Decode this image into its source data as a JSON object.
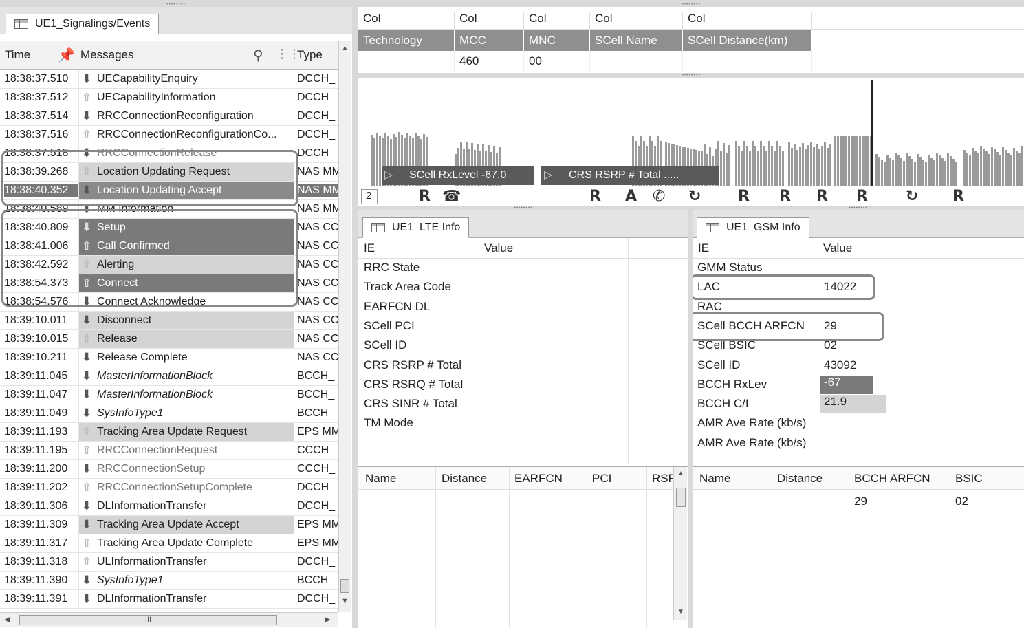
{
  "left_panel": {
    "tab_title": "UE1_Signalings/Events",
    "columns": {
      "time": "Time",
      "messages": "Messages",
      "type": "Type"
    },
    "rows": [
      {
        "time": "18:38:37.510",
        "dir": "down",
        "msg": "UECapabilityEnquiry",
        "type": "DCCH_",
        "style": ""
      },
      {
        "time": "18:38:37.512",
        "dir": "up",
        "msg": "UECapabilityInformation",
        "type": "DCCH_",
        "style": ""
      },
      {
        "time": "18:38:37.514",
        "dir": "down",
        "msg": "RRCConnectionReconfiguration",
        "type": "DCCH_",
        "style": ""
      },
      {
        "time": "18:38:37.516",
        "dir": "up",
        "msg": "RRCConnectionReconfigurationCo...",
        "type": "DCCH_",
        "style": ""
      },
      {
        "time": "18:38:37.518",
        "dir": "down",
        "msg": "RRCConnectionRelease",
        "type": "DCCH_",
        "style": "dim"
      },
      {
        "time": "18:38:39.268",
        "dir": "up",
        "msg": "Location Updating Request",
        "type": "NAS MM",
        "style": "light"
      },
      {
        "time": "18:38:40.352",
        "dir": "down",
        "msg": "Location Updating Accept",
        "type": "NAS MM",
        "style": "sel"
      },
      {
        "time": "18:38:40.589",
        "dir": "down",
        "msg": "MM Information",
        "type": "NAS MM",
        "style": ""
      },
      {
        "time": "18:38:40.809",
        "dir": "down",
        "msg": "Setup",
        "type": "NAS CC",
        "style": "dark"
      },
      {
        "time": "18:38:41.006",
        "dir": "up",
        "msg": "Call Confirmed",
        "type": "NAS CC",
        "style": "dark"
      },
      {
        "time": "18:38:42.592",
        "dir": "up",
        "msg": "Alerting",
        "type": "NAS CC",
        "style": "light"
      },
      {
        "time": "18:38:54.373",
        "dir": "up",
        "msg": "Connect",
        "type": "NAS CC",
        "style": "dark"
      },
      {
        "time": "18:38:54.576",
        "dir": "down",
        "msg": "Connect Acknowledge",
        "type": "NAS CC",
        "style": ""
      },
      {
        "time": "18:39:10.011",
        "dir": "down",
        "msg": "Disconnect",
        "type": "NAS CC",
        "style": "light"
      },
      {
        "time": "18:39:10.015",
        "dir": "up",
        "msg": "Release",
        "type": "NAS CC",
        "style": "light"
      },
      {
        "time": "18:39:10.211",
        "dir": "down",
        "msg": "Release Complete",
        "type": "NAS CC",
        "style": ""
      },
      {
        "time": "18:39:11.045",
        "dir": "down",
        "msg": "MasterInformationBlock",
        "type": "BCCH_",
        "style": "italic"
      },
      {
        "time": "18:39:11.047",
        "dir": "down",
        "msg": "MasterInformationBlock",
        "type": "BCCH_",
        "style": "italic"
      },
      {
        "time": "18:39:11.049",
        "dir": "down",
        "msg": "SysInfoType1",
        "type": "BCCH_",
        "style": "italic"
      },
      {
        "time": "18:39:11.193",
        "dir": "up",
        "msg": "Tracking Area Update Request",
        "type": "EPS MM",
        "style": "light"
      },
      {
        "time": "18:39:11.195",
        "dir": "up",
        "msg": "RRCConnectionRequest",
        "type": "CCCH_",
        "style": "dim"
      },
      {
        "time": "18:39:11.200",
        "dir": "down",
        "msg": "RRCConnectionSetup",
        "type": "CCCH_",
        "style": "dim"
      },
      {
        "time": "18:39:11.202",
        "dir": "up",
        "msg": "RRCConnectionSetupComplete",
        "type": "DCCH_",
        "style": "dim"
      },
      {
        "time": "18:39:11.306",
        "dir": "down",
        "msg": "DLInformationTransfer",
        "type": "DCCH_",
        "style": ""
      },
      {
        "time": "18:39:11.309",
        "dir": "down",
        "msg": "Tracking Area Update Accept",
        "type": "EPS MM",
        "style": "light"
      },
      {
        "time": "18:39:11.317",
        "dir": "up",
        "msg": "Tracking Area Update Complete",
        "type": "EPS MM",
        "style": ""
      },
      {
        "time": "18:39:11.318",
        "dir": "up",
        "msg": "ULInformationTransfer",
        "type": "DCCH_",
        "style": ""
      },
      {
        "time": "18:39:11.390",
        "dir": "down",
        "msg": "SysInfoType1",
        "type": "BCCH_",
        "style": "italic"
      },
      {
        "time": "18:39:11.391",
        "dir": "down",
        "msg": "DLInformationTransfer",
        "type": "DCCH_",
        "style": ""
      }
    ],
    "scroll_thumb_label": "III"
  },
  "top_grid": {
    "col_headers": [
      "Col",
      "Col",
      "Col",
      "Col",
      "Col"
    ],
    "field_headers": [
      "Technology",
      "MCC",
      "MNC",
      "SCell Name",
      "SCell Distance(km)"
    ],
    "values": [
      "",
      "460",
      "00",
      "",
      ""
    ]
  },
  "chart": {
    "labels": [
      "SCell RxLevel  -67.0",
      "CRS RSRP # Total  ....."
    ],
    "counter": "2",
    "markers": [
      "R",
      "☎",
      "R",
      "A",
      "✆",
      "↻",
      "R",
      "R",
      "R",
      "R",
      "↻",
      "R"
    ]
  },
  "lte_panel": {
    "tab_title": "UE1_LTE Info",
    "headers": [
      "IE",
      "Value"
    ],
    "items": [
      "RRC State",
      "Track Area Code",
      "EARFCN DL",
      "SCell PCI",
      "SCell ID",
      "CRS RSRP # Total",
      "CRS RSRQ # Total",
      "CRS SINR # Total",
      "TM Mode"
    ],
    "neighbor_headers": [
      "Name",
      "Distance",
      "EARFCN",
      "PCI",
      "RSF"
    ]
  },
  "gsm_panel": {
    "tab_title": "UE1_GSM Info",
    "headers": [
      "IE",
      "Value"
    ],
    "items": [
      {
        "ie": "GMM Status",
        "value": ""
      },
      {
        "ie": "LAC",
        "value": "14022"
      },
      {
        "ie": "RAC",
        "value": ""
      },
      {
        "ie": "SCell BCCH ARFCN",
        "value": "29"
      },
      {
        "ie": "SCell BSIC",
        "value": "02"
      },
      {
        "ie": "SCell ID",
        "value": "43092"
      },
      {
        "ie": "BCCH RxLev",
        "value": "-67"
      },
      {
        "ie": "BCCH C/I",
        "value": "21.9"
      },
      {
        "ie": "AMR Ave Rate (kb/s)",
        "value": ""
      },
      {
        "ie": "AMR Ave Rate (kb/s)",
        "value": ""
      }
    ],
    "neighbor_headers": [
      "Name",
      "Distance",
      "BCCH ARFCN",
      "BSIC"
    ],
    "neighbor_rows": [
      [
        "",
        "",
        "29",
        "02"
      ]
    ]
  },
  "colors": {
    "highlight_dark": "#7a7a7a",
    "highlight_light": "#d4d4d4",
    "callout": "#888888"
  }
}
